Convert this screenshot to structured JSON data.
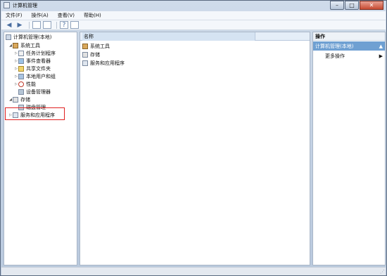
{
  "window": {
    "title": "计算机管理"
  },
  "menus": [
    "文件(F)",
    "操作(A)",
    "查看(V)",
    "帮助(H)"
  ],
  "tree": {
    "root": "计算机管理(本地)",
    "system_tools": "系统工具",
    "system_tools_children": [
      "任务计划程序",
      "事件查看器",
      "共享文件夹",
      "本地用户和组",
      "性能",
      "设备管理器"
    ],
    "storage": "存储",
    "storage_children": [
      "磁盘管理"
    ],
    "services": "服务和应用程序"
  },
  "content": {
    "column_header": "名称",
    "rows": [
      "系统工具",
      "存储",
      "服务和应用程序"
    ]
  },
  "actions": {
    "title": "操作",
    "selected": "计算机管理(本地)",
    "more": "更多操作"
  },
  "colors": {
    "selection": "#6fa0d2",
    "highlight_box": "#e02020"
  }
}
